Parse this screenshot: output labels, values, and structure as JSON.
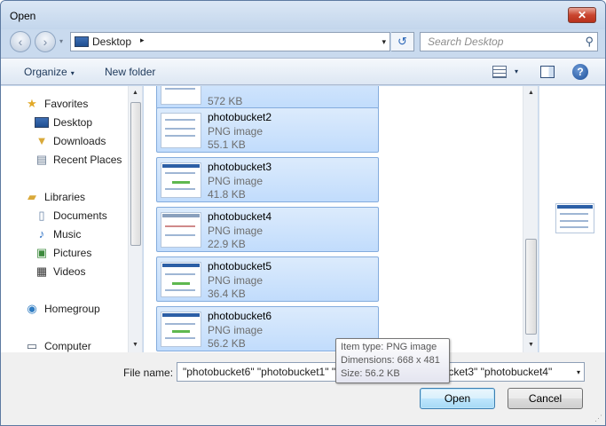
{
  "window": {
    "title": "Open",
    "close_glyph": "✕"
  },
  "address": {
    "location": "Desktop",
    "separator": "▸",
    "dropdown": "▾",
    "refresh_glyph": "↺"
  },
  "search": {
    "placeholder": "Search Desktop",
    "icon": "search-icon"
  },
  "nav_buttons": {
    "back": "‹",
    "forward": "›",
    "recent": "▾"
  },
  "toolbar": {
    "organize": "Organize",
    "organize_caret": "▾",
    "new_folder": "New folder",
    "views_caret": "▾",
    "help": "?"
  },
  "nav": {
    "favorites": "Favorites",
    "desktop": "Desktop",
    "downloads": "Downloads",
    "recent_places": "Recent Places",
    "libraries": "Libraries",
    "documents": "Documents",
    "music": "Music",
    "pictures": "Pictures",
    "videos": "Videos",
    "homegroup": "Homegroup",
    "computer": "Computer"
  },
  "files": [
    {
      "name": "",
      "type": "",
      "size": "572 KB"
    },
    {
      "name": "photobucket2",
      "type": "PNG image",
      "size": "55.1 KB"
    },
    {
      "name": "photobucket3",
      "type": "PNG image",
      "size": "41.8 KB"
    },
    {
      "name": "photobucket4",
      "type": "PNG image",
      "size": "22.9 KB"
    },
    {
      "name": "photobucket5",
      "type": "PNG image",
      "size": "36.4 KB"
    },
    {
      "name": "photobucket6",
      "type": "PNG image",
      "size": "56.2 KB"
    }
  ],
  "filename": {
    "label": "File name:",
    "value": "\"photobucket6\" \"photobucket1\" \"photobucket2\" \"photobucket3\" \"photobucket4\"",
    "dropdown": "▾"
  },
  "buttons": {
    "open": "Open",
    "cancel": "Cancel"
  },
  "tooltip": {
    "item_type": "Item type: PNG image",
    "dimensions": "Dimensions: 668 x 481",
    "size": "Size: 56.2 KB"
  }
}
